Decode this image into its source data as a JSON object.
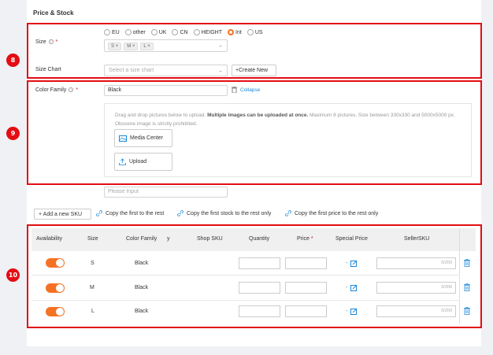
{
  "section": {
    "title": "Price & Stock"
  },
  "badges": {
    "b8": "8",
    "b9": "9",
    "b10": "10"
  },
  "size": {
    "label": "Size",
    "required": "*",
    "info": "i",
    "options": [
      "EU",
      "other",
      "UK",
      "CN",
      "HEIGHT",
      "Int",
      "US"
    ],
    "selected": "Int",
    "tags": [
      "S",
      "M",
      "L"
    ],
    "tag_remove": "×"
  },
  "size_chart": {
    "label": "Size Chart",
    "placeholder": "Select a size chart",
    "create_new": "+Create New"
  },
  "color_family": {
    "label": "Color Family",
    "required": "*",
    "info": "i",
    "value": "Black",
    "collapse": "Collapse",
    "drop_text_1": "Drag and drop pictures below to upload.",
    "drop_text_bold": "Multiple images can be uploaded at once.",
    "drop_text_2": "Maximum 8 pictures. Size between 330x330 and 5000x5000 px. Obscene image is strictly prohibited.",
    "media_center": "Media Center",
    "upload": "Upload",
    "please_input": "Please Input"
  },
  "actions": {
    "add_sku": "+ Add a new SKU",
    "copy_first": "Copy the first to the rest",
    "copy_stock": "Copy the first stock to the rest only",
    "copy_price": "Copy the first price to the rest only"
  },
  "table": {
    "headers": {
      "availability": "Availability",
      "size": "Size",
      "color_family": "Color Family",
      "y": "y",
      "shop_sku": "Shop SKU",
      "quantity": "Quantity",
      "price": "Price",
      "price_req": "*",
      "special_price": "Special Price",
      "seller_sku": "SellerSKU"
    },
    "rows": [
      {
        "size": "S",
        "color": "Black",
        "counter": "0/200",
        "dash": "-"
      },
      {
        "size": "M",
        "color": "Black",
        "counter": "0/200",
        "dash": "-"
      },
      {
        "size": "L",
        "color": "Black",
        "counter": "0/200",
        "dash": "-"
      }
    ]
  },
  "colors": {
    "accent": "#f57224",
    "annotation": "#e30d13",
    "link": "#1a88d9"
  }
}
